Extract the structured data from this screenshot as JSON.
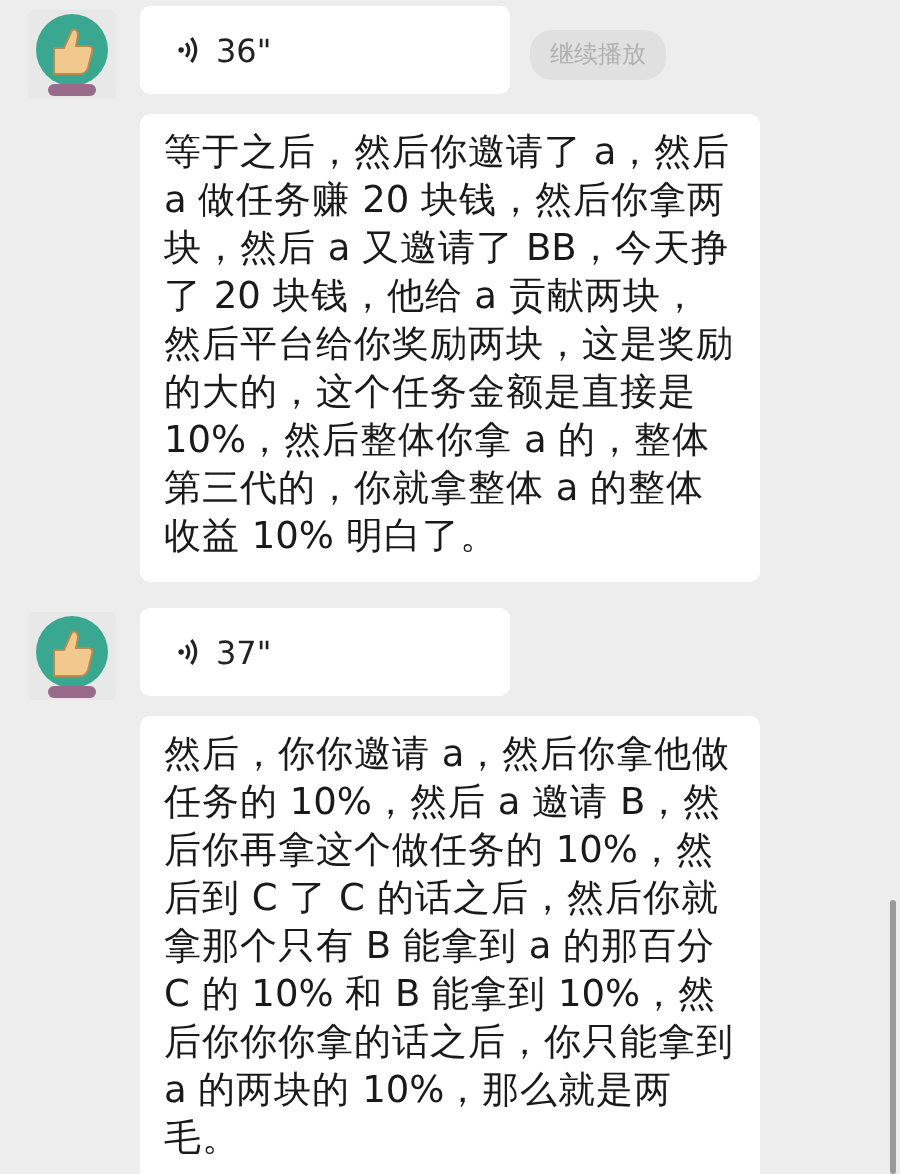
{
  "messages": [
    {
      "kind": "voice",
      "duration": "36\"",
      "continue_label": "继续播放"
    },
    {
      "kind": "text",
      "text": "等于之后，然后你邀请了 a，然后 a 做任务赚 20 块钱，然后你拿两块，然后 a 又邀请了 BB，今天挣了 20 块钱，他给 a 贡献两块，然后平台给你奖励两块，这是奖励的大的，这个任务金额是直接是 10%，然后整体你拿 a 的，整体第三代的，你就拿整体 a 的整体收益 10% 明白了。"
    },
    {
      "kind": "voice",
      "duration": "37\""
    },
    {
      "kind": "text",
      "text": "然后，你你邀请 a，然后你拿他做任务的 10%，然后 a 邀请 B，然后你再拿这个做任务的 10%，然后到 C 了 C 的话之后，然后你就拿那个只有 B 能拿到 a 的那百分 C 的 10% 和 B 能拿到 10%，然后你你你拿的话之后，你只能拿到 a 的两块的 10%，那么就是两毛。"
    }
  ]
}
